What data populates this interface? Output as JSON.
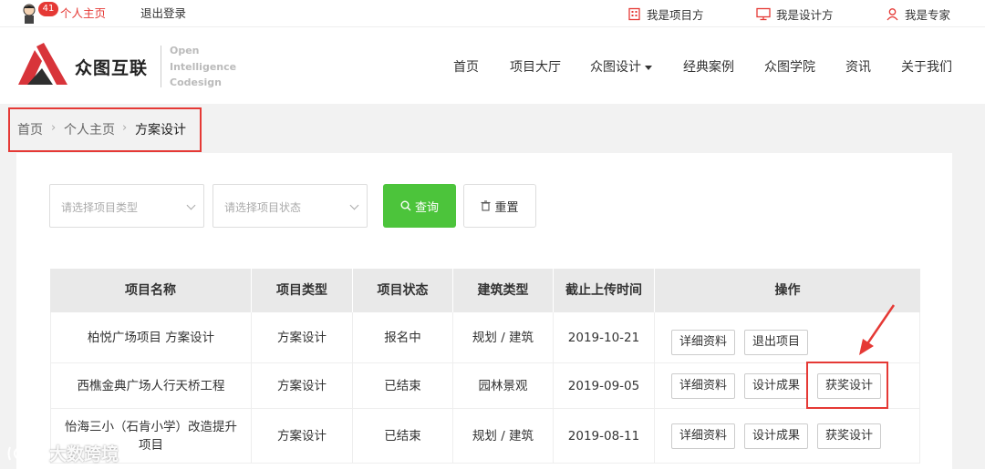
{
  "topbar": {
    "badge_count": "41",
    "personal_home": "个人主页",
    "logout": "退出登录",
    "roles": [
      {
        "label": "我是项目方",
        "icon": "building-icon"
      },
      {
        "label": "我是设计方",
        "icon": "monitor-icon"
      },
      {
        "label": "我是专家",
        "icon": "user-icon"
      }
    ]
  },
  "header": {
    "logo_cn": "众图互联",
    "logo_en": [
      "Open",
      "Intelligence",
      "Codesign"
    ],
    "nav": [
      "首页",
      "项目大厅",
      "众图设计",
      "经典案例",
      "众图学院",
      "资讯",
      "关于我们"
    ]
  },
  "breadcrumb": [
    "首页",
    "个人主页",
    "方案设计"
  ],
  "filters": {
    "type_placeholder": "请选择项目类型",
    "status_placeholder": "请选择项目状态",
    "query_label": "查询",
    "reset_label": "重置"
  },
  "table": {
    "headers": [
      "项目名称",
      "项目类型",
      "项目状态",
      "建筑类型",
      "截止上传时间",
      "操作"
    ],
    "rows": [
      {
        "name": "柏悦广场项目 方案设计",
        "type": "方案设计",
        "status": "报名中",
        "building": "规划 / 建筑",
        "deadline": "2019-10-21",
        "actions": [
          "详细资料",
          "退出项目"
        ]
      },
      {
        "name": "西樵金典广场人行天桥工程",
        "type": "方案设计",
        "status": "已结束",
        "building": "园林景观",
        "deadline": "2019-09-05",
        "actions": [
          "详细资料",
          "设计成果",
          "获奖设计"
        ]
      },
      {
        "name": "怡海三小（石肯小学）改造提升项目",
        "type": "方案设计",
        "status": "已结束",
        "building": "规划 / 建筑",
        "deadline": "2019-08-11",
        "actions": [
          "详细资料",
          "设计成果",
          "获奖设计"
        ]
      }
    ]
  },
  "watermark": "大数跨境",
  "colors": {
    "accent_red": "#e53935",
    "query_green": "#4cc43b"
  }
}
